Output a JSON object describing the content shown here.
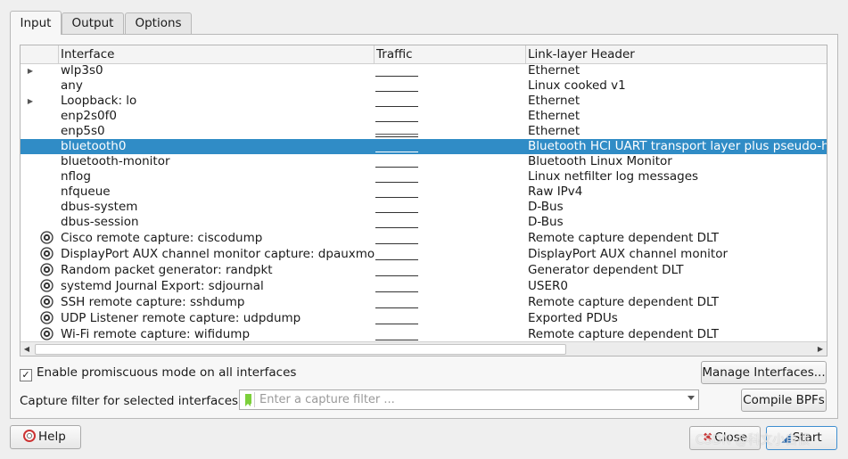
{
  "tabs": [
    {
      "label": "Input",
      "active": true
    },
    {
      "label": "Output",
      "active": false
    },
    {
      "label": "Options",
      "active": false
    }
  ],
  "table": {
    "columns": [
      "Interface",
      "Traffic",
      "Link-layer Header"
    ],
    "rows": [
      {
        "name": "wlp3s0",
        "link": "Ethernet",
        "arrow": true,
        "icon": "",
        "selected": false
      },
      {
        "name": "any",
        "link": "Linux cooked v1",
        "arrow": false,
        "icon": "",
        "selected": false
      },
      {
        "name": "Loopback: lo",
        "link": "Ethernet",
        "arrow": true,
        "icon": "",
        "selected": false
      },
      {
        "name": "enp2s0f0",
        "link": "Ethernet",
        "arrow": false,
        "icon": "",
        "selected": false
      },
      {
        "name": "enp5s0",
        "link": "Ethernet",
        "arrow": false,
        "icon": "",
        "selected": false,
        "activity": true
      },
      {
        "name": "bluetooth0",
        "link": "Bluetooth HCI UART transport layer plus pseudo-header",
        "arrow": false,
        "icon": "",
        "selected": true
      },
      {
        "name": "bluetooth-monitor",
        "link": "Bluetooth Linux Monitor",
        "arrow": false,
        "icon": "",
        "selected": false
      },
      {
        "name": "nflog",
        "link": "Linux netfilter log messages",
        "arrow": false,
        "icon": "",
        "selected": false
      },
      {
        "name": "nfqueue",
        "link": "Raw IPv4",
        "arrow": false,
        "icon": "",
        "selected": false
      },
      {
        "name": "dbus-system",
        "link": "D-Bus",
        "arrow": false,
        "icon": "",
        "selected": false
      },
      {
        "name": "dbus-session",
        "link": "D-Bus",
        "arrow": false,
        "icon": "",
        "selected": false
      },
      {
        "name": "Cisco remote capture: ciscodump",
        "link": "Remote capture dependent DLT",
        "arrow": false,
        "icon": "extcap-gear-icon",
        "selected": false
      },
      {
        "name": "DisplayPort AUX channel monitor capture: dpauxmon",
        "link": "DisplayPort AUX channel monitor",
        "arrow": false,
        "icon": "extcap-gear-icon",
        "selected": false
      },
      {
        "name": "Random packet generator: randpkt",
        "link": "Generator dependent DLT",
        "arrow": false,
        "icon": "extcap-gear-icon",
        "selected": false
      },
      {
        "name": "systemd Journal Export: sdjournal",
        "link": "USER0",
        "arrow": false,
        "icon": "extcap-gear-icon",
        "selected": false
      },
      {
        "name": "SSH remote capture: sshdump",
        "link": "Remote capture dependent DLT",
        "arrow": false,
        "icon": "extcap-gear-icon",
        "selected": false
      },
      {
        "name": "UDP Listener remote capture: udpdump",
        "link": "Exported PDUs",
        "arrow": false,
        "icon": "extcap-gear-icon",
        "selected": false
      },
      {
        "name": "Wi-Fi remote capture: wifidump",
        "link": "Remote capture dependent DLT",
        "arrow": false,
        "icon": "extcap-gear-icon",
        "selected": false
      }
    ]
  },
  "promiscuous": {
    "label": "Enable promiscuous mode on all interfaces",
    "checked": true
  },
  "buttons": {
    "manage": "Manage Interfaces...",
    "compile": "Compile BPFs",
    "help": "Help",
    "close": "Close",
    "start": "Start"
  },
  "filter": {
    "label": "Capture filter for selected interfaces:",
    "placeholder": "Enter a capture filter ...",
    "value": ""
  },
  "watermark": "CSDN @科文小自很",
  "colors": {
    "selection": "#308cc6",
    "filter_bookmark": "#7cd03b"
  }
}
